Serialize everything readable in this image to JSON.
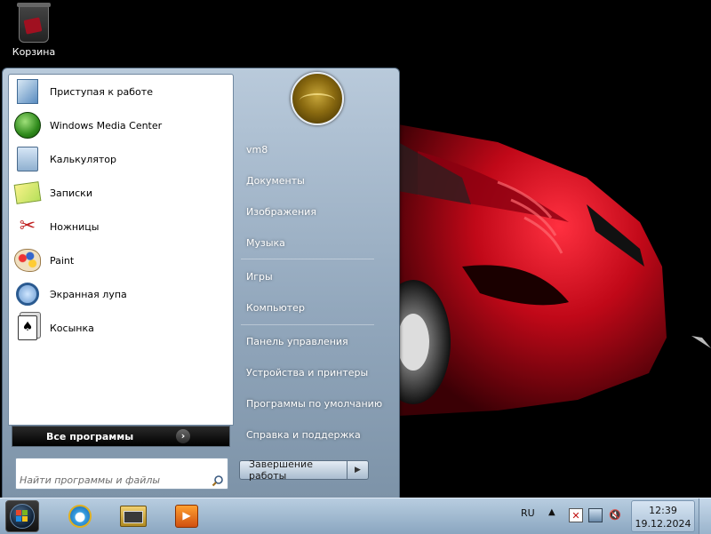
{
  "desktop": {
    "icons": [
      {
        "label": "Корзина",
        "icon": "recycle-bin-icon"
      }
    ]
  },
  "start_menu": {
    "programs": [
      {
        "label": "Приступая к работе",
        "icon": "getting-started-icon"
      },
      {
        "label": "Windows Media Center",
        "icon": "media-center-icon"
      },
      {
        "label": "Калькулятор",
        "icon": "calculator-icon"
      },
      {
        "label": "Записки",
        "icon": "sticky-notes-icon"
      },
      {
        "label": "Ножницы",
        "icon": "snipping-tool-icon"
      },
      {
        "label": "Paint",
        "icon": "paint-icon"
      },
      {
        "label": "Экранная лупа",
        "icon": "magnifier-icon"
      },
      {
        "label": "Косынка",
        "icon": "solitaire-icon"
      }
    ],
    "all_programs_label": "Все программы",
    "search_placeholder": "Найти программы и файлы",
    "right_items": [
      {
        "label": "vm8"
      },
      {
        "label": "Документы"
      },
      {
        "label": "Изображения"
      },
      {
        "label": "Музыка"
      },
      {
        "label": "Игры"
      },
      {
        "label": "Компьютер"
      },
      {
        "label": "Панель управления"
      },
      {
        "label": "Устройства и принтеры"
      },
      {
        "label": "Программы по умолчанию"
      },
      {
        "label": "Справка и поддержка"
      }
    ],
    "shutdown_label": "Завершение работы"
  },
  "taskbar": {
    "pinned": [
      {
        "name": "internet-explorer",
        "icon": "internet-explorer-icon"
      },
      {
        "name": "windows-explorer",
        "icon": "folder-icon"
      },
      {
        "name": "media-player",
        "icon": "media-player-icon"
      }
    ],
    "language": "RU",
    "clock": {
      "time": "12:39",
      "date": "19.12.2024"
    }
  }
}
